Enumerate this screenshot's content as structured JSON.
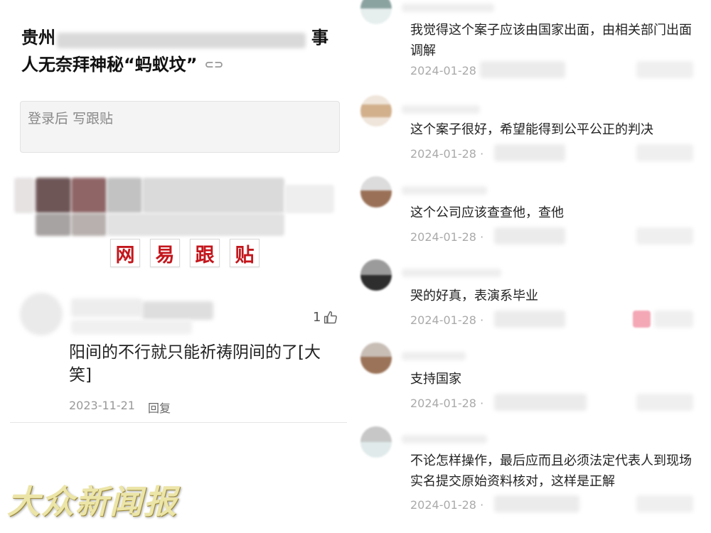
{
  "left_panel": {
    "article_title_line1": "贵州",
    "article_title_line1_end": "事",
    "article_title_line2": "人无奈拜神秘“蚂蚁坟”",
    "link_icon": "link-icon",
    "follow_placeholder": "登录后  写跟贴",
    "netease_banner": [
      "网",
      "易",
      "跟",
      "贴"
    ],
    "comment": {
      "likes": "1",
      "text": "阳间的不行就只能祈祷阴间的了[大笑]",
      "date": "2023-11-21",
      "reply_label": "回复"
    },
    "watermark": "大众新闻报"
  },
  "right_panel": {
    "comments": [
      {
        "text": "我觉得这个案子应该由国家出面，由相关部门出面调解",
        "date": "2024-01-28"
      },
      {
        "text": "这个案子很好，希望能得到公平公正的判决",
        "date": "2024-01-28 ·"
      },
      {
        "text": "这个公司应该查查他，查他",
        "date": "2024-01-28 ·"
      },
      {
        "text": "哭的好真，表演系毕业",
        "date": "2024-01-28 ·"
      },
      {
        "text": "支持国家",
        "date": "2024-01-28 ·"
      },
      {
        "text": "不论怎样操作，最后应而且必须法定代表人到现场实名提交原始资料核对，这样是正解",
        "date": "2024-01-28 ·"
      }
    ]
  },
  "colors": {
    "netease_red": "#c3161c",
    "meta_gray": "#999999",
    "watermark_gold": "#ece5a8"
  }
}
